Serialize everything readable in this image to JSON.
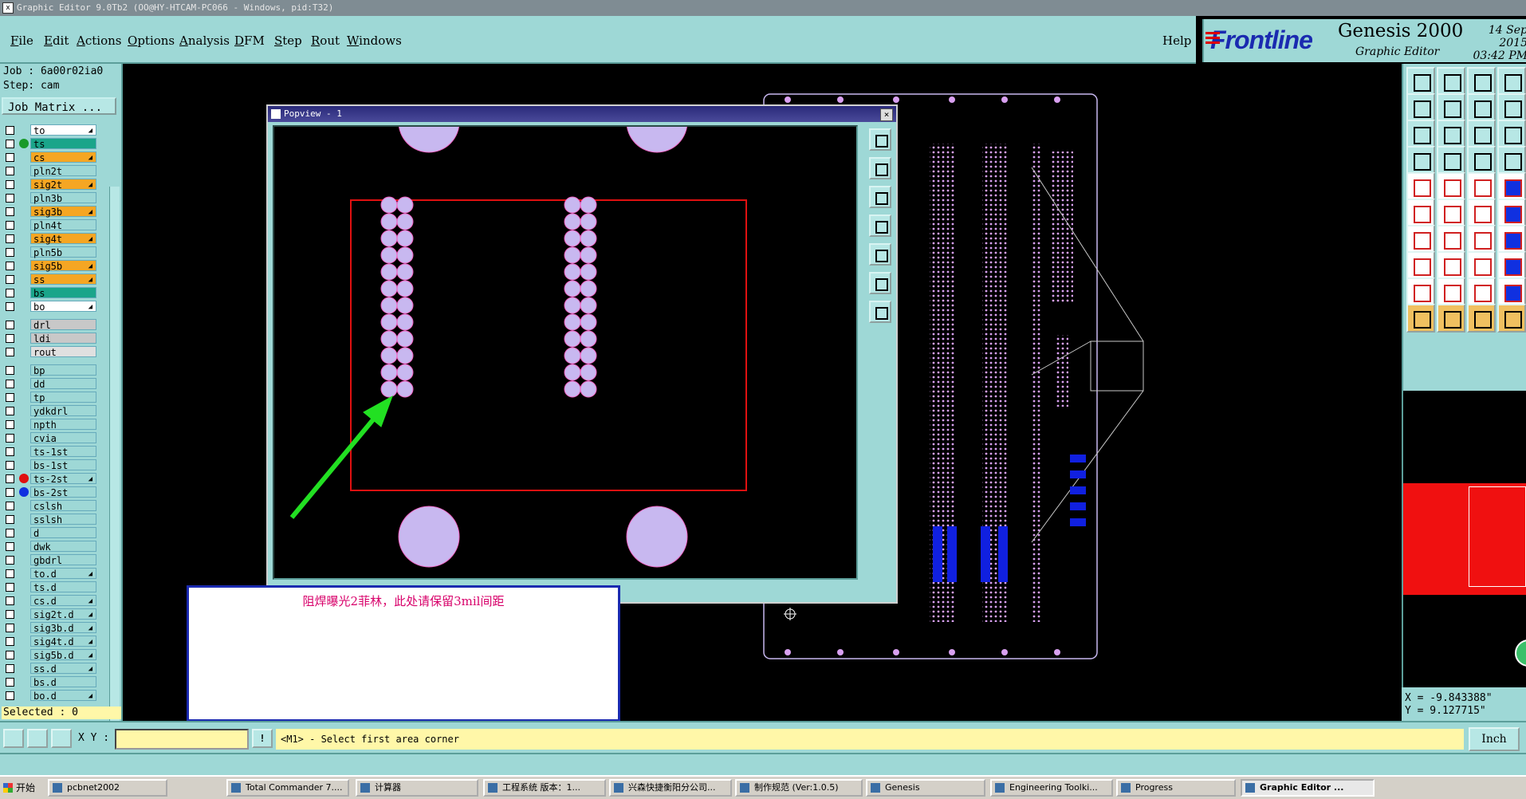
{
  "window": {
    "title": "Graphic Editor 9.0Tb2 (OO@HY-HTCAM-PC066 - Windows, pid:T32)"
  },
  "menu": {
    "items": [
      "File",
      "Edit",
      "Actions",
      "Options",
      "Analysis",
      "DFM",
      "Step",
      "Rout",
      "Windows"
    ],
    "help": "Help"
  },
  "brand": {
    "logo": "Frontline",
    "product": "Genesis 2000",
    "subtitle": "Graphic Editor",
    "date": "14 Sep 2015",
    "time": "03:42 PM"
  },
  "job": {
    "job_line": "Job : 6a00r02ia0",
    "step_line": "Step: cam",
    "matrix_button": "Job Matrix ..."
  },
  "layers": [
    {
      "name": "to",
      "color": "#ffffff",
      "dot": "",
      "arrow": true
    },
    {
      "name": "ts",
      "color": "#1aa58a",
      "dot": "#1a9a2a",
      "arrow": false
    },
    {
      "name": "cs",
      "color": "#f5a623",
      "dot": "",
      "arrow": true
    },
    {
      "name": "pln2t",
      "color": "#9ed8d6",
      "dot": "",
      "arrow": false
    },
    {
      "name": "sig2t",
      "color": "#f5a623",
      "dot": "",
      "arrow": true
    },
    {
      "name": "pln3b",
      "color": "#9ed8d6",
      "dot": "",
      "arrow": false
    },
    {
      "name": "sig3b",
      "color": "#f5a623",
      "dot": "",
      "arrow": true
    },
    {
      "name": "pln4t",
      "color": "#9ed8d6",
      "dot": "",
      "arrow": false
    },
    {
      "name": "sig4t",
      "color": "#f5a623",
      "dot": "",
      "arrow": true
    },
    {
      "name": "pln5b",
      "color": "#9ed8d6",
      "dot": "",
      "arrow": false
    },
    {
      "name": "sig5b",
      "color": "#f5a623",
      "dot": "",
      "arrow": true
    },
    {
      "name": "ss",
      "color": "#f5a623",
      "dot": "",
      "arrow": true
    },
    {
      "name": "bs",
      "color": "#1aa58a",
      "dot": "",
      "arrow": false
    },
    {
      "name": "bo",
      "color": "#ffffff",
      "dot": "",
      "arrow": true
    },
    {
      "name": "drl",
      "color": "#c8c8c8",
      "dot": "",
      "arrow": false
    },
    {
      "name": "ldi",
      "color": "#c8c8c8",
      "dot": "",
      "arrow": false
    },
    {
      "name": "rout",
      "color": "#e0e0e0",
      "dot": "",
      "arrow": false
    },
    {
      "name": "bp",
      "color": "#9ed8d6",
      "dot": "",
      "arrow": false
    },
    {
      "name": "dd",
      "color": "#9ed8d6",
      "dot": "",
      "arrow": false
    },
    {
      "name": "tp",
      "color": "#9ed8d6",
      "dot": "",
      "arrow": false
    },
    {
      "name": "ydkdrl",
      "color": "#9ed8d6",
      "dot": "",
      "arrow": false
    },
    {
      "name": "npth",
      "color": "#9ed8d6",
      "dot": "",
      "arrow": false
    },
    {
      "name": "cvia",
      "color": "#9ed8d6",
      "dot": "",
      "arrow": false
    },
    {
      "name": "ts-1st",
      "color": "#9ed8d6",
      "dot": "",
      "arrow": false
    },
    {
      "name": "bs-1st",
      "color": "#9ed8d6",
      "dot": "",
      "arrow": false
    },
    {
      "name": "ts-2st",
      "color": "#9ed8d6",
      "dot": "#e01010",
      "arrow": true
    },
    {
      "name": "bs-2st",
      "color": "#9ed8d6",
      "dot": "#1030e0",
      "arrow": false
    },
    {
      "name": "cslsh",
      "color": "#9ed8d6",
      "dot": "",
      "arrow": false
    },
    {
      "name": "sslsh",
      "color": "#9ed8d6",
      "dot": "",
      "arrow": false
    },
    {
      "name": "d",
      "color": "#9ed8d6",
      "dot": "",
      "arrow": false
    },
    {
      "name": "dwk",
      "color": "#9ed8d6",
      "dot": "",
      "arrow": false
    },
    {
      "name": "gbdrl",
      "color": "#9ed8d6",
      "dot": "",
      "arrow": false
    },
    {
      "name": "to.d",
      "color": "#9ed8d6",
      "dot": "",
      "arrow": true
    },
    {
      "name": "ts.d",
      "color": "#9ed8d6",
      "dot": "",
      "arrow": false
    },
    {
      "name": "cs.d",
      "color": "#9ed8d6",
      "dot": "",
      "arrow": true
    },
    {
      "name": "sig2t.d",
      "color": "#9ed8d6",
      "dot": "",
      "arrow": true
    },
    {
      "name": "sig3b.d",
      "color": "#9ed8d6",
      "dot": "",
      "arrow": true
    },
    {
      "name": "sig4t.d",
      "color": "#9ed8d6",
      "dot": "",
      "arrow": true
    },
    {
      "name": "sig5b.d",
      "color": "#9ed8d6",
      "dot": "",
      "arrow": true
    },
    {
      "name": "ss.d",
      "color": "#9ed8d6",
      "dot": "",
      "arrow": true
    },
    {
      "name": "bs.d",
      "color": "#9ed8d6",
      "dot": "",
      "arrow": false
    },
    {
      "name": "bo.d",
      "color": "#9ed8d6",
      "dot": "",
      "arrow": true
    }
  ],
  "selected": "Selected : 0",
  "popview": {
    "title": "Popview - 1"
  },
  "note": {
    "text": "阻焊曝光2菲林，此处请保留3mil间距"
  },
  "coords": {
    "x": "X = -9.843388\"",
    "y": "Y = 9.127715\""
  },
  "command": {
    "xy_label": "X Y :",
    "prompt": "<M1> - Select first area corner",
    "units": "Inch"
  },
  "taskbar": {
    "start": "开始",
    "tasks": [
      "pcbnet2002",
      "Total Commander 7....",
      "计算器",
      "工程系统   版本：1...",
      "兴森快捷衡阳分公司...",
      "制作规范 (Ver:1.0.5)",
      "Genesis",
      "Engineering Toolki...",
      "Progress",
      "Graphic Editor ..."
    ]
  },
  "colors": {
    "panel": "#9ed8d6",
    "pad": "#c8b8f0",
    "highlight": "#e01010",
    "arrow": "#22e022",
    "note_text": "#d8006a"
  }
}
